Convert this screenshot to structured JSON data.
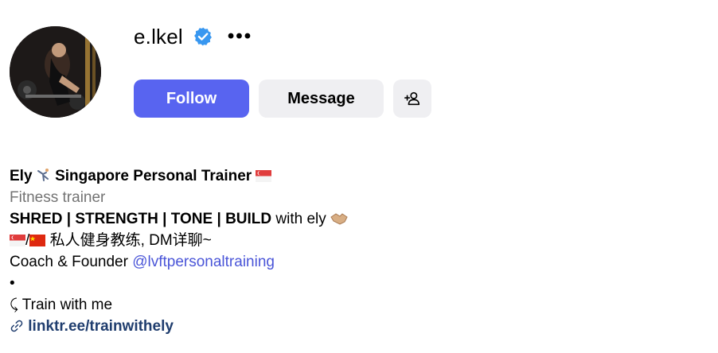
{
  "profile": {
    "username": "e.lkel",
    "verified": true,
    "more_label": "•••"
  },
  "actions": {
    "follow_label": "Follow",
    "message_label": "Message"
  },
  "bio": {
    "display_name": "Ely",
    "display_name_rest": "Singapore Personal Trainer",
    "category": "Fitness trainer",
    "line3_bold": "SHRED | STRENGTH | TONE | BUILD",
    "line3_rest": "with ely",
    "line4_text": "私人健身教练, DM详聊~",
    "line5_prefix": "Coach & Founder",
    "line5_mention": "@lvftpersonaltraining",
    "line6_bullet": "•",
    "line7_arrow": "⤹",
    "line7_text": "Train with me",
    "link_text": "linktr.ee/trainwithely"
  },
  "colors": {
    "follow_bg": "#5864f0",
    "secondary_btn_bg": "#efeff2",
    "verified_blue": "#3897f0",
    "mention_blue": "#4a55d8",
    "link_navy": "#1f3d6e",
    "category_gray": "#737373"
  },
  "icons": {
    "verified": "verified-badge-icon",
    "more": "more-horizontal-icon",
    "add_user": "add-user-icon",
    "link": "link-icon",
    "flag": "singapore-flag-icon",
    "gymnast": "person-cartwheel-icon",
    "handshake": "handshake-icon"
  }
}
